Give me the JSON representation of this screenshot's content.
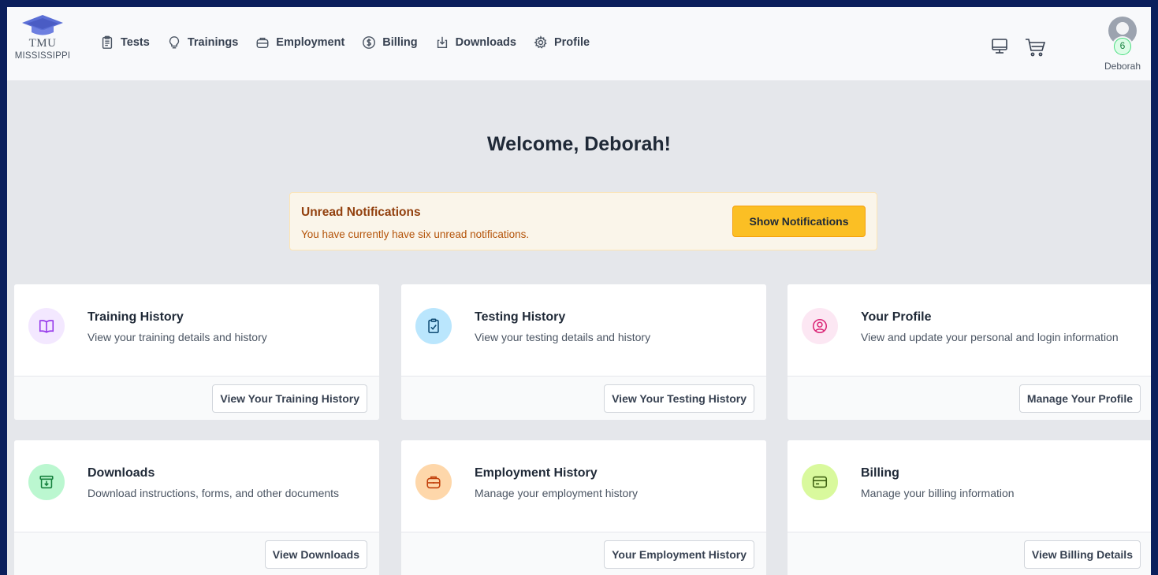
{
  "brand": {
    "name": "TMU",
    "state": "MISSISSIPPI"
  },
  "nav": [
    {
      "label": "Tests",
      "icon": "clipboard-icon"
    },
    {
      "label": "Trainings",
      "icon": "lightbulb-icon"
    },
    {
      "label": "Employment",
      "icon": "briefcase-icon"
    },
    {
      "label": "Billing",
      "icon": "dollar-icon"
    },
    {
      "label": "Downloads",
      "icon": "download-icon"
    },
    {
      "label": "Profile",
      "icon": "gear-icon"
    }
  ],
  "user": {
    "name": "Deborah",
    "notification_count": "6"
  },
  "welcome": "Welcome, Deborah!",
  "notification": {
    "title": "Unread Notifications",
    "text": "You have currently have six unread notifications.",
    "button": "Show Notifications"
  },
  "cards": [
    {
      "title": "Training History",
      "desc": "View your training details and history",
      "button": "View Your Training History",
      "icon": "book-icon",
      "icon_bg": "#f3e8ff",
      "icon_color": "#9333ea"
    },
    {
      "title": "Testing History",
      "desc": "View your testing details and history",
      "button": "View Your Testing History",
      "icon": "clipboard-check-icon",
      "icon_bg": "#bae6fd",
      "icon_color": "#0f4c75"
    },
    {
      "title": "Your Profile",
      "desc": "View and update your personal and login information",
      "button": "Manage Your Profile",
      "icon": "user-circle-icon",
      "icon_bg": "#fce7f3",
      "icon_color": "#db2777"
    },
    {
      "title": "Downloads",
      "desc": "Download instructions, forms, and other documents",
      "button": "View Downloads",
      "icon": "archive-download-icon",
      "icon_bg": "#bbf7d0",
      "icon_color": "#15803d"
    },
    {
      "title": "Employment History",
      "desc": "Manage your employment history",
      "button": "Your Employment History",
      "icon": "briefcase-icon",
      "icon_bg": "#fed7aa",
      "icon_color": "#c2410c"
    },
    {
      "title": "Billing",
      "desc": "Manage your billing information",
      "button": "View Billing Details",
      "icon": "credit-card-icon",
      "icon_bg": "#d9f99d",
      "icon_color": "#3f6212"
    }
  ]
}
